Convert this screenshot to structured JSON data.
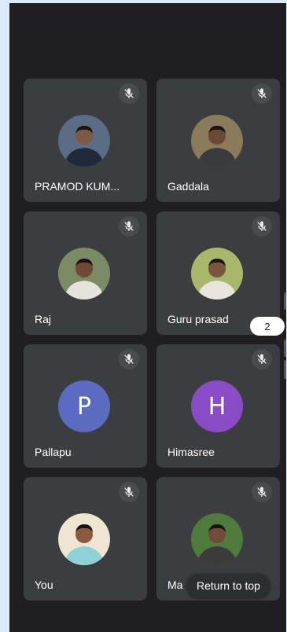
{
  "participants": [
    {
      "name": "PRAMOD KUM...",
      "muted": true,
      "avatar": {
        "type": "photo",
        "icon": "person-photo-suit",
        "bg": "#5a6c86",
        "shirt": "#1e2a3a",
        "skin": "#7a5a46"
      }
    },
    {
      "name": "Gaddala",
      "muted": true,
      "avatar": {
        "type": "photo",
        "icon": "person-photo-award",
        "bg": "#8a7b5a",
        "shirt": "#3a3b40",
        "skin": "#6b4a35"
      }
    },
    {
      "name": "Raj",
      "muted": true,
      "avatar": {
        "type": "photo",
        "icon": "person-photo-outdoor",
        "bg": "#7b8b66",
        "shirt": "#e6e2dc",
        "skin": "#6e4a36"
      }
    },
    {
      "name": "Guru prasad",
      "muted": true,
      "avatar": {
        "type": "photo",
        "icon": "person-photo-garden",
        "bg": "#a8b86a",
        "shirt": "#e8e4de",
        "skin": "#7a5540"
      }
    },
    {
      "name": "Pallapu",
      "muted": true,
      "avatar": {
        "type": "letter",
        "letter": "P",
        "bg": "#5b6bbf"
      }
    },
    {
      "name": "Himasree",
      "muted": true,
      "avatar": {
        "type": "letter",
        "letter": "H",
        "bg": "#8a4bc7"
      }
    },
    {
      "name": "You",
      "muted": true,
      "avatar": {
        "type": "photo",
        "icon": "person-photo-self",
        "bg": "#efe6d2",
        "shirt": "#8ed1d6",
        "skin": "#8a5a40"
      }
    },
    {
      "name": "Ma",
      "muted": true,
      "avatar": {
        "type": "photo",
        "icon": "person-photo-trees",
        "bg": "#4e7a3c",
        "shirt": "#3b3b3b",
        "skin": "#6e4c38"
      }
    }
  ],
  "overflow_badge": "2",
  "return_to_top_label": "Return to top",
  "colors": {
    "background": "#1f1f21",
    "tile": "#3c3d3f",
    "mic_circle": "#4a4b4e",
    "text": "#ffffff"
  }
}
